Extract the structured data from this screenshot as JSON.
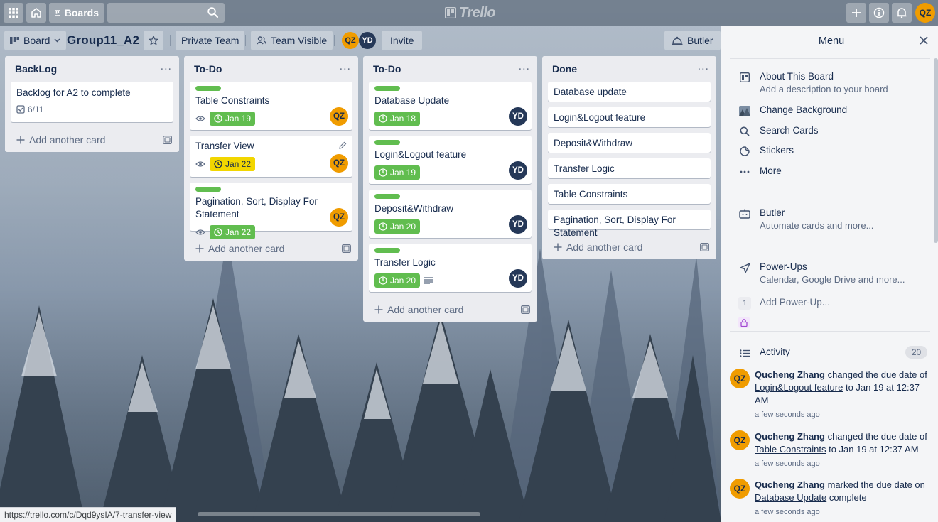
{
  "topbar": {
    "boards_label": "Boards",
    "search_placeholder": "",
    "logo_text": "Trello",
    "user_initials": "QZ"
  },
  "board": {
    "view_label": "Board",
    "title": "Group11_A2",
    "team_label": "Private Team",
    "visibility_label": "Team Visible",
    "members": [
      "QZ",
      "YD"
    ],
    "invite_label": "Invite",
    "butler_label": "Butler"
  },
  "lists": [
    {
      "title": "BackLog",
      "cards": [
        {
          "title": "Backlog for A2 to complete",
          "checklist": "6/11"
        }
      ],
      "add_label": "Add another card"
    },
    {
      "title": "To-Do",
      "cards": [
        {
          "title": "Table Constraints",
          "due": "Jan 19",
          "member": "QZ"
        },
        {
          "title": "Transfer View",
          "due": "Jan 22",
          "member": "QZ"
        },
        {
          "title": "Pagination, Sort, Display For Statement",
          "due": "Jan 22",
          "member": "QZ"
        }
      ],
      "add_label": "Add another card"
    },
    {
      "title": "To-Do",
      "cards": [
        {
          "title": "Database Update",
          "due": "Jan 18",
          "member": "YD"
        },
        {
          "title": "Login&Logout feature",
          "due": "Jan 19",
          "member": "YD"
        },
        {
          "title": "Deposit&Withdraw",
          "due": "Jan 20",
          "member": "YD"
        },
        {
          "title": "Transfer Logic",
          "due": "Jan 20",
          "member": "YD"
        }
      ],
      "add_label": "Add another card"
    },
    {
      "title": "Done",
      "cards": [
        {
          "title": "Database update"
        },
        {
          "title": "Login&Logout feature"
        },
        {
          "title": "Deposit&Withdraw"
        },
        {
          "title": "Transfer Logic"
        },
        {
          "title": "Table Constraints"
        },
        {
          "title": "Pagination, Sort, Display For Statement"
        }
      ],
      "add_label": "Add another card"
    }
  ],
  "menu": {
    "title": "Menu",
    "items": [
      {
        "label": "About This Board",
        "sub": "Add a description to your board"
      },
      {
        "label": "Change Background"
      },
      {
        "label": "Search Cards"
      },
      {
        "label": "Stickers"
      },
      {
        "label": "More"
      }
    ],
    "butler": {
      "label": "Butler",
      "sub": "Automate cards and more..."
    },
    "powerups": {
      "label": "Power-Ups",
      "sub": "Calendar, Google Drive and more...",
      "add_count": "1",
      "add_label": "Add Power-Up..."
    },
    "activity": {
      "label": "Activity",
      "count": "20",
      "entries": [
        {
          "initials": "QZ",
          "user": "Qucheng Zhang",
          "action": "changed the due date of",
          "link": "Login&Logout feature",
          "rest": "to Jan 19 at 12:37 AM",
          "time": "a few seconds ago"
        },
        {
          "initials": "QZ",
          "user": "Qucheng Zhang",
          "action": "changed the due date of",
          "link": "Table Constraints",
          "rest": "to Jan 19 at 12:37 AM",
          "time": "a few seconds ago"
        },
        {
          "initials": "QZ",
          "user": "Qucheng Zhang",
          "action": "marked the due date on",
          "link": "Database Update",
          "rest": "complete",
          "time": "a few seconds ago"
        }
      ]
    }
  },
  "status_url": "https://trello.com/c/Dqd9ysIA/7-transfer-view",
  "colors": {
    "label_green": "#61bd4f",
    "due_complete": "#61bd4f",
    "due_soon": "#f2d600",
    "qz_avatar": "#f09c00",
    "yd_avatar": "#253858"
  }
}
